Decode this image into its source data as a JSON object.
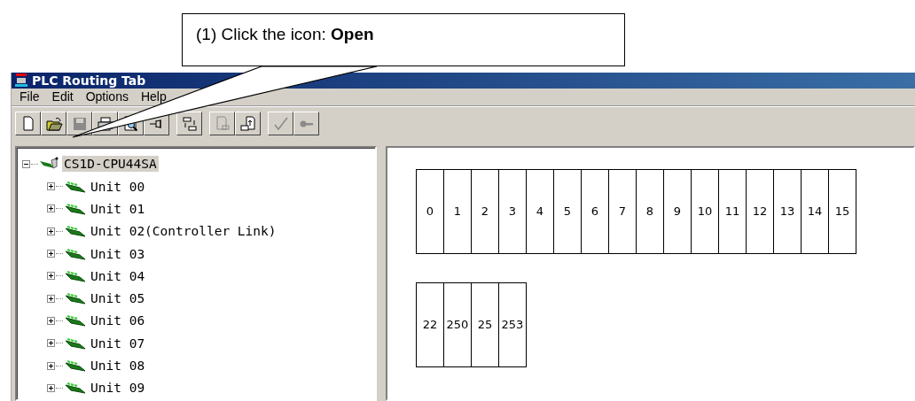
{
  "callout": {
    "text": "(1) Click the icon: **Open**"
  },
  "window": {
    "title": "PLC Routing Tab"
  },
  "menu": [
    "File",
    "Edit",
    "Options",
    "Help"
  ],
  "toolbar": [
    {
      "kind": "new",
      "disabled": false
    },
    {
      "kind": "open",
      "disabled": false
    },
    {
      "kind": "save",
      "disabled": true
    },
    {
      "kind": "print",
      "disabled": false
    },
    {
      "kind": "preview",
      "disabled": false
    },
    {
      "kind": "pin",
      "disabled": false
    },
    {
      "kind": "transfer",
      "disabled": false
    },
    {
      "kind": "download",
      "disabled": true
    },
    {
      "kind": "upload",
      "disabled": false
    },
    {
      "kind": "check",
      "disabled": true
    },
    {
      "kind": "key",
      "disabled": true
    }
  ],
  "tree": {
    "label": "CS1D-CPU44SA",
    "expanded": true,
    "selected": true,
    "children": [
      {
        "label": "Unit 00",
        "expanded": false,
        "selected": false
      },
      {
        "label": "Unit 01",
        "expanded": false,
        "selected": false
      },
      {
        "label": "Unit 02(Controller Link)",
        "expanded": false,
        "selected": false
      },
      {
        "label": "Unit 03",
        "expanded": false,
        "selected": false
      },
      {
        "label": "Unit 04",
        "expanded": false,
        "selected": false
      },
      {
        "label": "Unit 05",
        "expanded": false,
        "selected": false
      },
      {
        "label": "Unit 06",
        "expanded": false,
        "selected": false
      },
      {
        "label": "Unit 07",
        "expanded": false,
        "selected": false
      },
      {
        "label": "Unit 08",
        "expanded": false,
        "selected": false
      },
      {
        "label": "Unit 09",
        "expanded": false,
        "selected": false
      }
    ]
  },
  "unit_slots": [
    "0",
    "1",
    "2",
    "3",
    "4",
    "5",
    "6",
    "7",
    "8",
    "9",
    "10",
    "11",
    "12",
    "13",
    "14",
    "15"
  ],
  "node_slots": [
    "22",
    "250",
    "25",
    "253"
  ]
}
